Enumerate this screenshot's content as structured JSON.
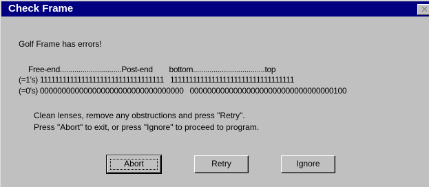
{
  "window": {
    "title": "Check Frame",
    "close_glyph": "✕"
  },
  "message": {
    "headline": "Golf Frame has errors!",
    "header_row": "Free-end..............................Post-end        bottom...................................top",
    "row_ones": "(=1's) 111111111111111111111111111111111   111111111111111111111111111111111",
    "row_zeros": "(=0's) 000000000000000000000000000000000   000000000000000000000000000000000100",
    "instruction_1": "Clean lenses, remove any obstructions and press \"Retry\".",
    "instruction_2": "Press \"Abort\" to exit, or press \"Ignore\" to proceed to program."
  },
  "buttons": {
    "abort": "Abort",
    "retry": "Retry",
    "ignore": "Ignore"
  }
}
